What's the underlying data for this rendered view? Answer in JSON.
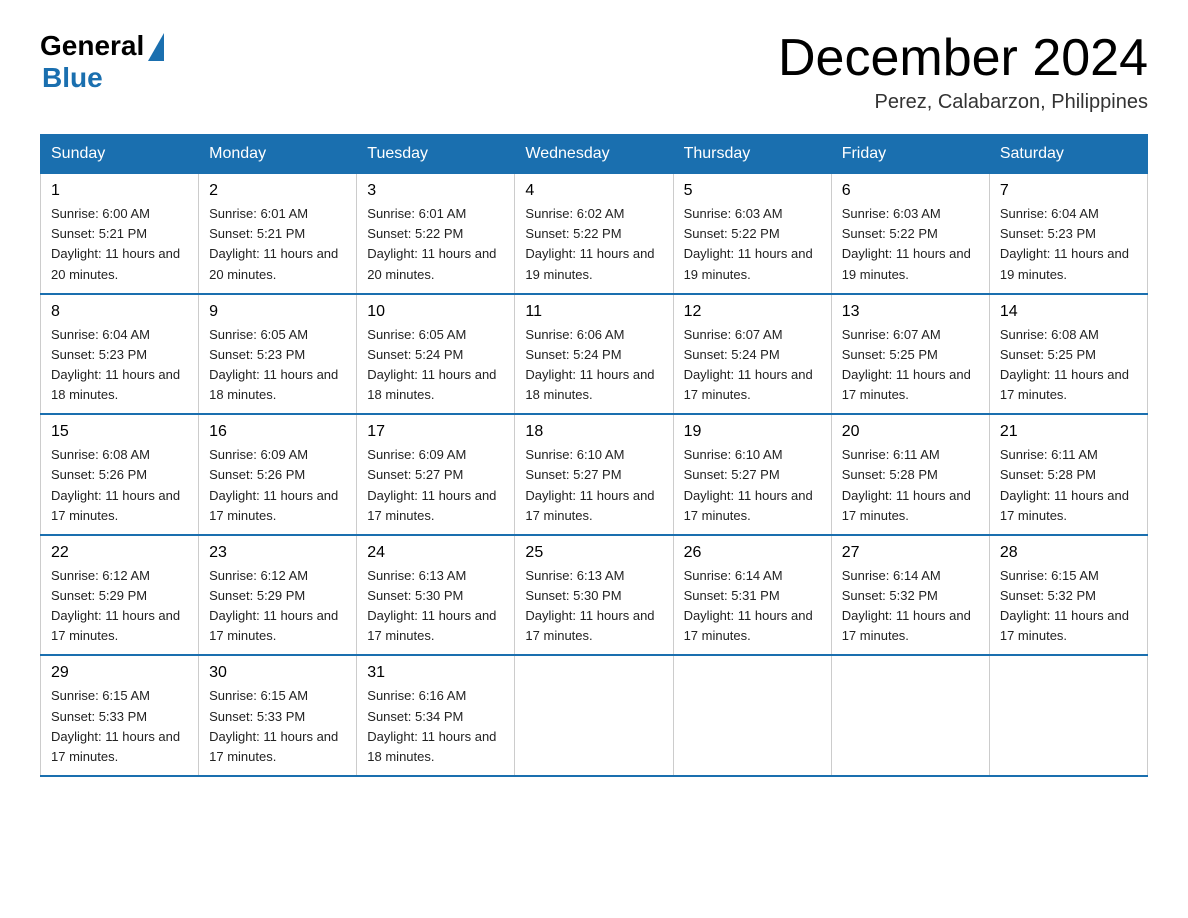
{
  "logo": {
    "general": "General",
    "blue": "Blue"
  },
  "title": "December 2024",
  "location": "Perez, Calabarzon, Philippines",
  "days_of_week": [
    "Sunday",
    "Monday",
    "Tuesday",
    "Wednesday",
    "Thursday",
    "Friday",
    "Saturday"
  ],
  "weeks": [
    [
      {
        "day": "1",
        "sunrise": "6:00 AM",
        "sunset": "5:21 PM",
        "daylight": "11 hours and 20 minutes."
      },
      {
        "day": "2",
        "sunrise": "6:01 AM",
        "sunset": "5:21 PM",
        "daylight": "11 hours and 20 minutes."
      },
      {
        "day": "3",
        "sunrise": "6:01 AM",
        "sunset": "5:22 PM",
        "daylight": "11 hours and 20 minutes."
      },
      {
        "day": "4",
        "sunrise": "6:02 AM",
        "sunset": "5:22 PM",
        "daylight": "11 hours and 19 minutes."
      },
      {
        "day": "5",
        "sunrise": "6:03 AM",
        "sunset": "5:22 PM",
        "daylight": "11 hours and 19 minutes."
      },
      {
        "day": "6",
        "sunrise": "6:03 AM",
        "sunset": "5:22 PM",
        "daylight": "11 hours and 19 minutes."
      },
      {
        "day": "7",
        "sunrise": "6:04 AM",
        "sunset": "5:23 PM",
        "daylight": "11 hours and 19 minutes."
      }
    ],
    [
      {
        "day": "8",
        "sunrise": "6:04 AM",
        "sunset": "5:23 PM",
        "daylight": "11 hours and 18 minutes."
      },
      {
        "day": "9",
        "sunrise": "6:05 AM",
        "sunset": "5:23 PM",
        "daylight": "11 hours and 18 minutes."
      },
      {
        "day": "10",
        "sunrise": "6:05 AM",
        "sunset": "5:24 PM",
        "daylight": "11 hours and 18 minutes."
      },
      {
        "day": "11",
        "sunrise": "6:06 AM",
        "sunset": "5:24 PM",
        "daylight": "11 hours and 18 minutes."
      },
      {
        "day": "12",
        "sunrise": "6:07 AM",
        "sunset": "5:24 PM",
        "daylight": "11 hours and 17 minutes."
      },
      {
        "day": "13",
        "sunrise": "6:07 AM",
        "sunset": "5:25 PM",
        "daylight": "11 hours and 17 minutes."
      },
      {
        "day": "14",
        "sunrise": "6:08 AM",
        "sunset": "5:25 PM",
        "daylight": "11 hours and 17 minutes."
      }
    ],
    [
      {
        "day": "15",
        "sunrise": "6:08 AM",
        "sunset": "5:26 PM",
        "daylight": "11 hours and 17 minutes."
      },
      {
        "day": "16",
        "sunrise": "6:09 AM",
        "sunset": "5:26 PM",
        "daylight": "11 hours and 17 minutes."
      },
      {
        "day": "17",
        "sunrise": "6:09 AM",
        "sunset": "5:27 PM",
        "daylight": "11 hours and 17 minutes."
      },
      {
        "day": "18",
        "sunrise": "6:10 AM",
        "sunset": "5:27 PM",
        "daylight": "11 hours and 17 minutes."
      },
      {
        "day": "19",
        "sunrise": "6:10 AM",
        "sunset": "5:27 PM",
        "daylight": "11 hours and 17 minutes."
      },
      {
        "day": "20",
        "sunrise": "6:11 AM",
        "sunset": "5:28 PM",
        "daylight": "11 hours and 17 minutes."
      },
      {
        "day": "21",
        "sunrise": "6:11 AM",
        "sunset": "5:28 PM",
        "daylight": "11 hours and 17 minutes."
      }
    ],
    [
      {
        "day": "22",
        "sunrise": "6:12 AM",
        "sunset": "5:29 PM",
        "daylight": "11 hours and 17 minutes."
      },
      {
        "day": "23",
        "sunrise": "6:12 AM",
        "sunset": "5:29 PM",
        "daylight": "11 hours and 17 minutes."
      },
      {
        "day": "24",
        "sunrise": "6:13 AM",
        "sunset": "5:30 PM",
        "daylight": "11 hours and 17 minutes."
      },
      {
        "day": "25",
        "sunrise": "6:13 AM",
        "sunset": "5:30 PM",
        "daylight": "11 hours and 17 minutes."
      },
      {
        "day": "26",
        "sunrise": "6:14 AM",
        "sunset": "5:31 PM",
        "daylight": "11 hours and 17 minutes."
      },
      {
        "day": "27",
        "sunrise": "6:14 AM",
        "sunset": "5:32 PM",
        "daylight": "11 hours and 17 minutes."
      },
      {
        "day": "28",
        "sunrise": "6:15 AM",
        "sunset": "5:32 PM",
        "daylight": "11 hours and 17 minutes."
      }
    ],
    [
      {
        "day": "29",
        "sunrise": "6:15 AM",
        "sunset": "5:33 PM",
        "daylight": "11 hours and 17 minutes."
      },
      {
        "day": "30",
        "sunrise": "6:15 AM",
        "sunset": "5:33 PM",
        "daylight": "11 hours and 17 minutes."
      },
      {
        "day": "31",
        "sunrise": "6:16 AM",
        "sunset": "5:34 PM",
        "daylight": "11 hours and 18 minutes."
      },
      null,
      null,
      null,
      null
    ]
  ]
}
